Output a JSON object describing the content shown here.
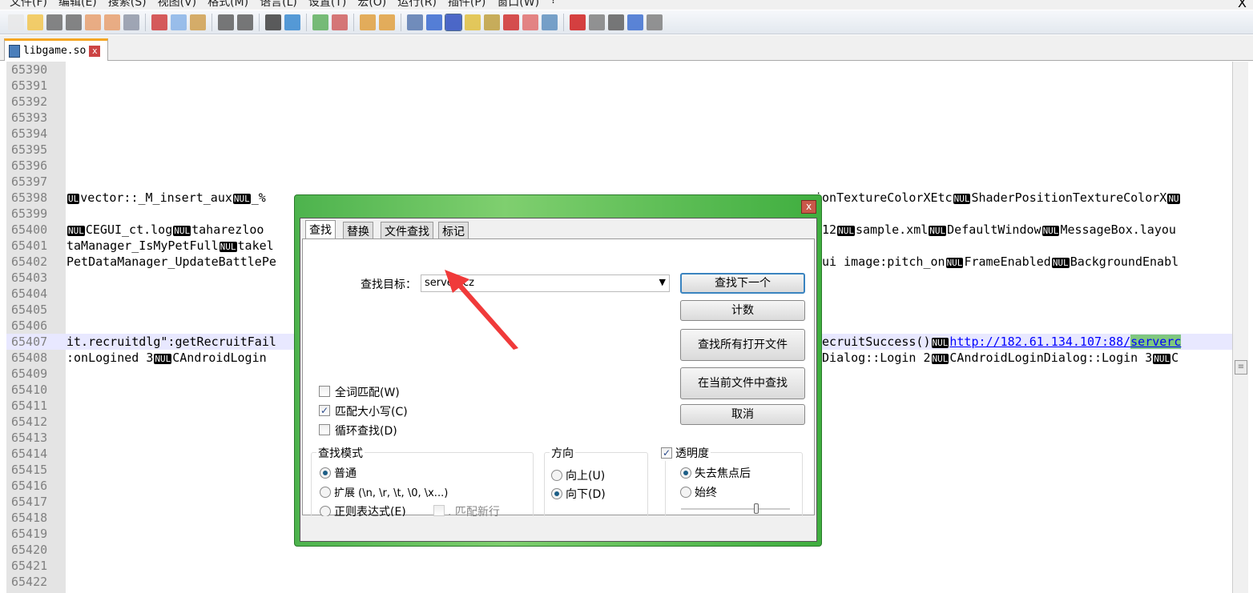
{
  "menu": [
    "文件(F)",
    "编辑(E)",
    "搜索(S)",
    "视图(V)",
    "格式(M)",
    "语言(L)",
    "设置(T)",
    "宏(O)",
    "运行(R)",
    "插件(P)",
    "窗口(W)",
    "?"
  ],
  "window_close": "X",
  "toolbar_icons": [
    {
      "name": "new-file",
      "color": "#e8e8e8"
    },
    {
      "name": "open-file",
      "color": "#f2c650"
    },
    {
      "name": "save",
      "color": "#707070"
    },
    {
      "name": "save-all",
      "color": "#707070"
    },
    {
      "name": "close",
      "color": "#e8a070"
    },
    {
      "name": "close-all",
      "color": "#e8a070"
    },
    {
      "name": "print",
      "color": "#9098a8"
    },
    {
      "name": "cut",
      "color": "#d04040"
    },
    {
      "name": "copy",
      "color": "#8ab4e8"
    },
    {
      "name": "paste",
      "color": "#d0a050"
    },
    {
      "name": "undo",
      "color": "#606060"
    },
    {
      "name": "redo",
      "color": "#606060"
    },
    {
      "name": "find",
      "color": "#404040"
    },
    {
      "name": "replace",
      "color": "#3a8ad0"
    },
    {
      "name": "zoom-in",
      "color": "#60b060"
    },
    {
      "name": "zoom-out",
      "color": "#d06060"
    },
    {
      "name": "sync-vertical",
      "color": "#e0a040"
    },
    {
      "name": "sync-horizontal",
      "color": "#e0a040"
    },
    {
      "name": "word-wrap",
      "color": "#5a7ab0"
    },
    {
      "name": "show-all-chars",
      "color": "#3a6ad0"
    },
    {
      "name": "indent-guide",
      "color": "#3050c0",
      "active": true
    },
    {
      "name": "user-language",
      "color": "#e0c040"
    },
    {
      "name": "doc-map",
      "color": "#c0a040"
    },
    {
      "name": "function-list",
      "color": "#d03030"
    },
    {
      "name": "folder-workspace",
      "color": "#e07070"
    },
    {
      "name": "monitoring",
      "color": "#6090c0"
    },
    {
      "name": "macro-record",
      "color": "#d02020"
    },
    {
      "name": "macro-stop",
      "color": "#808080"
    },
    {
      "name": "macro-play",
      "color": "#606060"
    },
    {
      "name": "macro-run-multiple",
      "color": "#4070d0"
    },
    {
      "name": "macro-save",
      "color": "#808080"
    }
  ],
  "tab": {
    "label": "libgame.so",
    "close": "x"
  },
  "editor": {
    "lines": [
      {
        "n": "65390"
      },
      {
        "n": "65391"
      },
      {
        "n": "65392"
      },
      {
        "n": "65393"
      },
      {
        "n": "65394"
      },
      {
        "n": "65395"
      },
      {
        "n": "65396"
      },
      {
        "n": "65397"
      },
      {
        "n": "65398",
        "left": [
          {
            "nul": "UL"
          },
          "vector::_M_insert_aux",
          {
            "nul": "NUL"
          },
          "_%"
        ],
        "right": [
          "ionTextureColorXEtc",
          {
            "nul": "NUL"
          },
          "ShaderPositionTextureColorX",
          {
            "nul": "NU"
          }
        ]
      },
      {
        "n": "65399"
      },
      {
        "n": "65400",
        "left": [
          {
            "nul": "NUL"
          },
          "CEGUI_ct.log",
          {
            "nul": "NUL"
          },
          "taharezloo"
        ],
        "right": [
          "-12",
          {
            "nul": "NUL"
          },
          "sample.xml",
          {
            "nul": "NUL"
          },
          "DefaultWindow",
          {
            "nul": "NUL"
          },
          "MessageBox.layou"
        ]
      },
      {
        "n": "65401",
        "left": [
          "taManager_IsMyPetFull",
          {
            "nul": "NUL"
          },
          "takel"
        ]
      },
      {
        "n": "65402",
        "left": [
          "PetDataManager_UpdateBattlePe"
        ],
        "right": [
          "tui image:pitch_on",
          {
            "nul": "NUL"
          },
          "FrameEnabled",
          {
            "nul": "NUL"
          },
          "BackgroundEnabl"
        ]
      },
      {
        "n": "65403"
      },
      {
        "n": "65404"
      },
      {
        "n": "65405"
      },
      {
        "n": "65406"
      },
      {
        "n": "65407",
        "current": true,
        "left": [
          "it.recruitdlg\":getRecruitFail"
        ],
        "right": [
          "RecruitSuccess()",
          {
            "nul": "NUL"
          },
          {
            "url": "http://182.61.134.107:88/"
          },
          {
            "hit": "serverc"
          }
        ]
      },
      {
        "n": "65408",
        "left": [
          ":onLogined 3",
          {
            "nul": "NUL"
          },
          "CAndroidLogin"
        ],
        "right": [
          "nDialog::Login 2",
          {
            "nul": "NUL"
          },
          "CAndroidLoginDialog::Login 3",
          {
            "nul": "NUL"
          },
          "C"
        ]
      },
      {
        "n": "65409"
      },
      {
        "n": "65410"
      },
      {
        "n": "65411"
      },
      {
        "n": "65412"
      },
      {
        "n": "65413"
      },
      {
        "n": "65414"
      },
      {
        "n": "65415"
      },
      {
        "n": "65416"
      },
      {
        "n": "65417"
      },
      {
        "n": "65418"
      },
      {
        "n": "65419"
      },
      {
        "n": "65420"
      },
      {
        "n": "65421"
      },
      {
        "n": "65422"
      }
    ]
  },
  "dialog": {
    "close": "x",
    "tabs": [
      "查找",
      "替换",
      "文件查找",
      "标记"
    ],
    "find_label": "查找目标：",
    "find_value": "serverccz",
    "buttons": {
      "find_next": "查找下一个",
      "count": "计数",
      "find_all_open": "查找所有打开文件",
      "find_in_current": "在当前文件中查找",
      "cancel": "取消"
    },
    "options": {
      "whole_word": {
        "label": "全词匹配(W)",
        "checked": false
      },
      "match_case": {
        "label": "匹配大小写(C)",
        "checked": true
      },
      "wrap": {
        "label": "循环查找(D)",
        "checked": false
      }
    },
    "search_mode": {
      "title": "查找模式",
      "normal": "普通",
      "extended": "扩展 (\\n, \\r, \\t, \\0, \\x...)",
      "regex": "正则表达式(E)",
      "dot_newline": ". 匹配新行",
      "selected": "normal"
    },
    "direction": {
      "title": "方向",
      "up": "向上(U)",
      "down": "向下(D)",
      "selected": "down"
    },
    "transparency": {
      "title": "透明度",
      "enabled": true,
      "on_lose_focus": "失去焦点后",
      "always": "始终",
      "selected": "on_lose_focus",
      "level": 0.7
    }
  },
  "annotation": {
    "arrow_color": "#f03a3a"
  }
}
